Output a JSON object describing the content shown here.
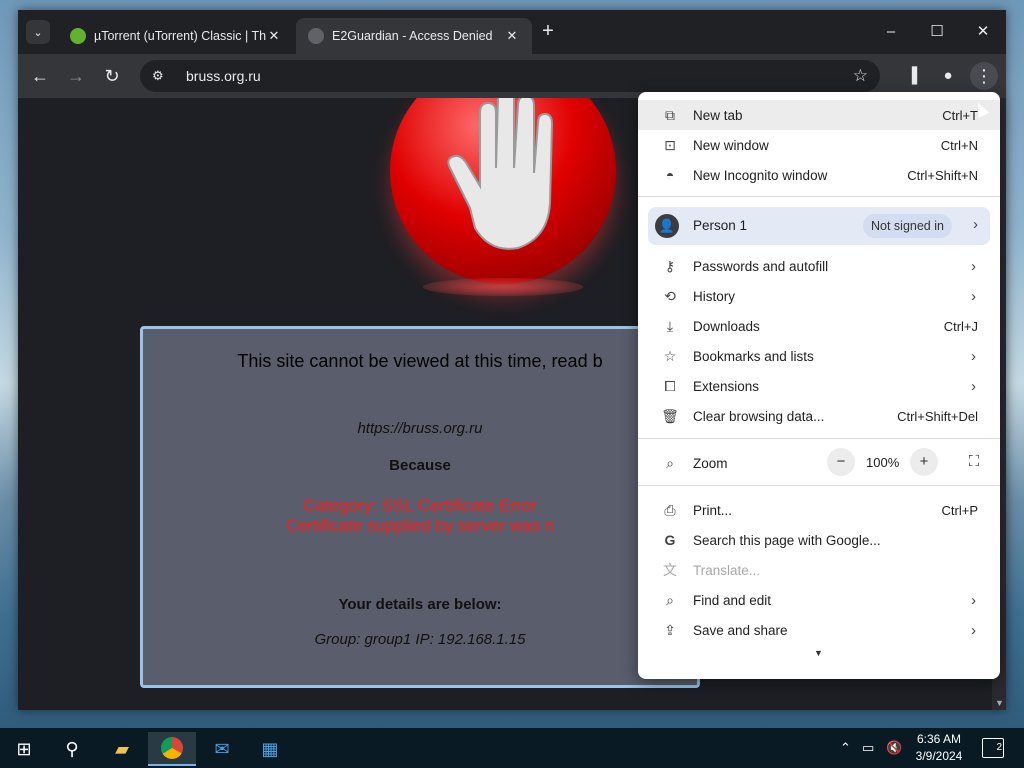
{
  "browser": {
    "tabs": [
      {
        "title": "µTorrent (uTorrent) Classic | The",
        "active": false
      },
      {
        "title": "E2Guardian - Access Denied",
        "active": true
      }
    ],
    "address": "bruss.org.ru",
    "icons": {
      "tab_search": "chevron-down-icon",
      "back": "back-arrow-icon",
      "forward": "forward-arrow-icon",
      "reload": "reload-icon",
      "site_info": "tune-icon",
      "bookmark": "star-icon",
      "side_panel": "side-panel-icon",
      "profile": "profile-icon",
      "menu": "kebab-menu-icon"
    }
  },
  "page": {
    "headline": "This site cannot be viewed at this time, read b",
    "blocked_url": "https://bruss.org.ru",
    "because": "Because",
    "category_line": "Category: SSL Certificate Error",
    "reason_line": "Certificate supplied by server was n",
    "details_heading": "Your details are below:",
    "group_ip": "Group: group1   IP: 192.168.1.15"
  },
  "menu": {
    "new_tab": {
      "label": "New tab",
      "shortcut": "Ctrl+T"
    },
    "new_window": {
      "label": "New window",
      "shortcut": "Ctrl+N"
    },
    "incognito": {
      "label": "New Incognito window",
      "shortcut": "Ctrl+Shift+N"
    },
    "person": {
      "name": "Person 1",
      "status": "Not signed in"
    },
    "passwords": {
      "label": "Passwords and autofill"
    },
    "history": {
      "label": "History"
    },
    "downloads": {
      "label": "Downloads",
      "shortcut": "Ctrl+J"
    },
    "bookmarks": {
      "label": "Bookmarks and lists"
    },
    "extensions": {
      "label": "Extensions"
    },
    "clear": {
      "label": "Clear browsing data...",
      "shortcut": "Ctrl+Shift+Del"
    },
    "zoom": {
      "label": "Zoom",
      "value": "100%",
      "minus": "−",
      "plus": "+"
    },
    "print": {
      "label": "Print...",
      "shortcut": "Ctrl+P"
    },
    "search_page": {
      "label": "Search this page with Google..."
    },
    "translate": {
      "label": "Translate..."
    },
    "find_edit": {
      "label": "Find and edit"
    },
    "save_share": {
      "label": "Save and share"
    }
  },
  "taskbar": {
    "time": "6:36 AM",
    "date": "3/9/2024",
    "notification_count": "2",
    "accent": "#7ab4e6"
  }
}
